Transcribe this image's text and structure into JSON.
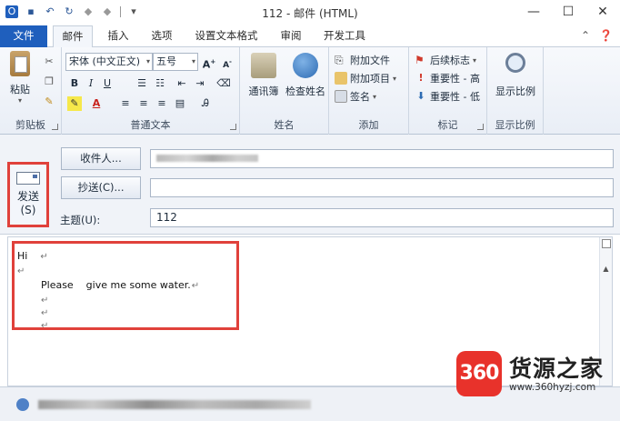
{
  "window": {
    "title": "112 - 邮件 (HTML)",
    "controls": {
      "minimize": "—",
      "maximize": "☐",
      "close": "✕"
    }
  },
  "tabs": [
    {
      "label": "文件"
    },
    {
      "label": "邮件"
    },
    {
      "label": "插入"
    },
    {
      "label": "选项"
    },
    {
      "label": "设置文本格式"
    },
    {
      "label": "审阅"
    },
    {
      "label": "开发工具"
    }
  ],
  "ribbon": {
    "clipboard": {
      "label": "剪贴板",
      "paste": "粘贴"
    },
    "basic_text": {
      "label": "普通文本",
      "font": "宋体 (中文正文)",
      "size": "五号",
      "bold": "B",
      "italic": "I",
      "underline": "U"
    },
    "names": {
      "label": "姓名",
      "address_book": "通讯簿",
      "check_names": "检查姓名"
    },
    "include": {
      "label": "添加",
      "attach_file": "附加文件",
      "attach_item": "附加项目",
      "signature": "签名"
    },
    "tags": {
      "label": "标记",
      "follow_up": "后续标志",
      "high": "重要性 - 高",
      "low": "重要性 - 低"
    },
    "zoom": {
      "label": "显示比例",
      "zoom": "显示比例"
    }
  },
  "header": {
    "send": {
      "label": "发送",
      "shortcut": "(S)"
    },
    "to_button": "收件人...",
    "cc_button": "抄送(C)...",
    "subject_label": "主题(U):",
    "subject_value": "112",
    "cc_value": ""
  },
  "body": {
    "line1": "Hi",
    "line3": "Please    give me some water.",
    "para_mark": "↵"
  },
  "watermark": {
    "logo": "360",
    "title": "货源之家",
    "url": "www.360hyzj.com"
  }
}
